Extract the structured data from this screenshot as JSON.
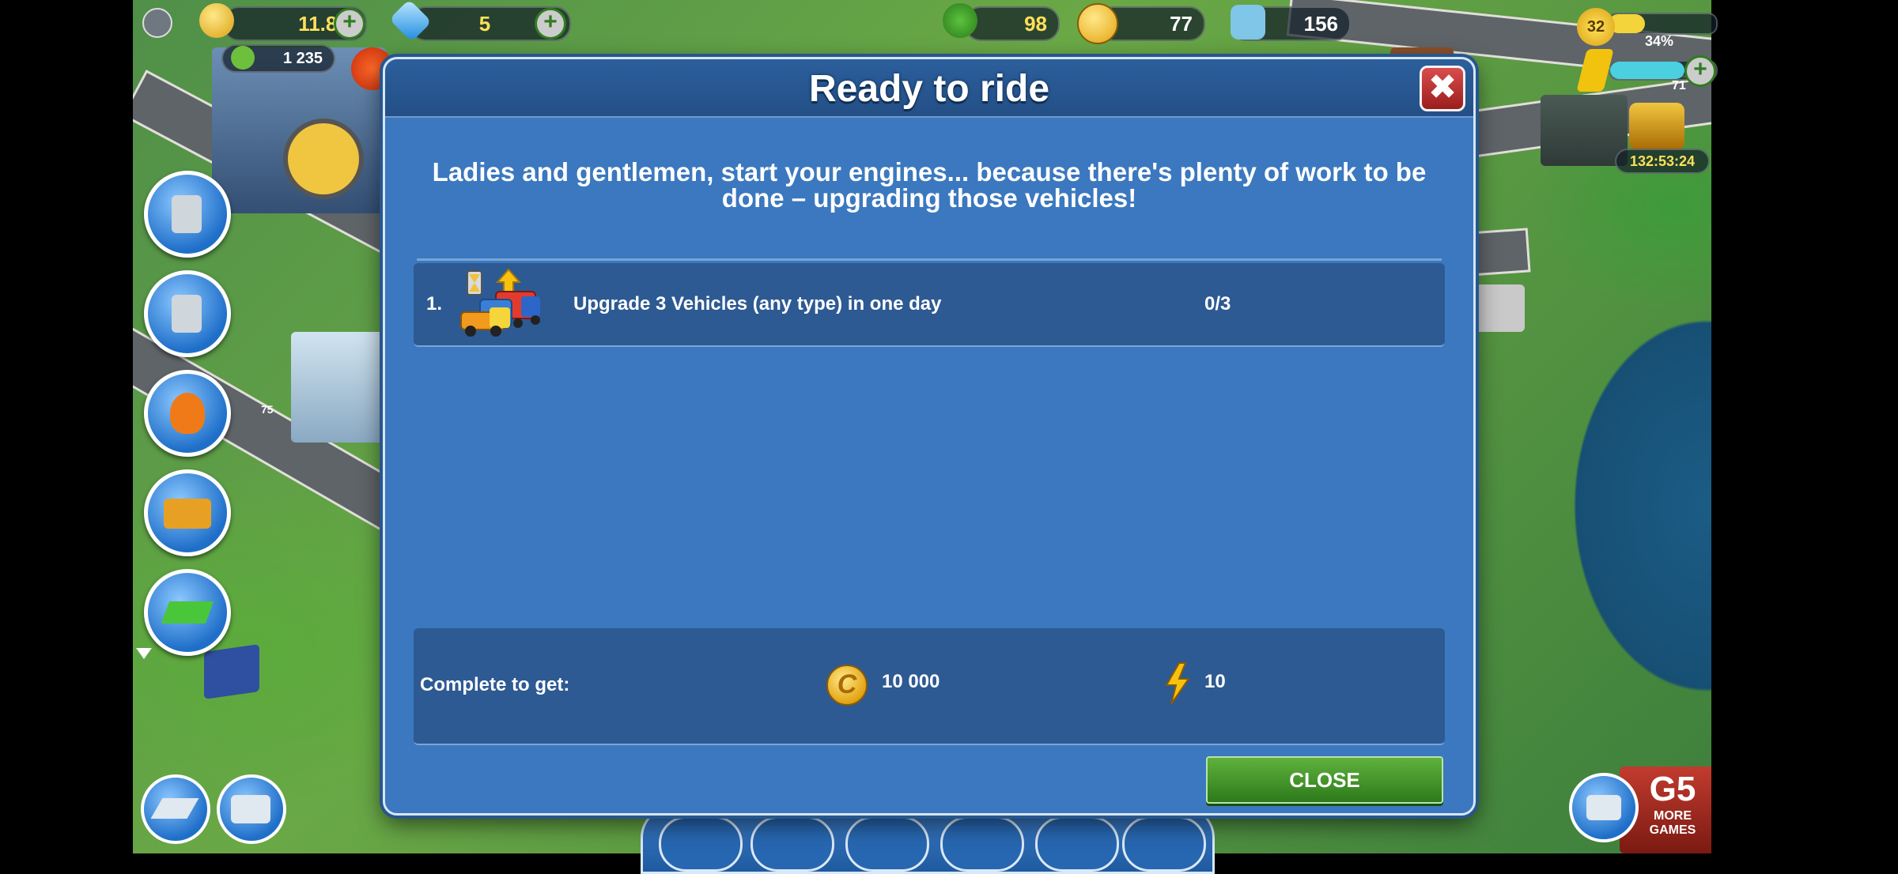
{
  "hud": {
    "money": "11.8M",
    "gems": "5",
    "trees": "98",
    "happiness": "77",
    "population": "156",
    "level": "32",
    "xp_percent": "34%",
    "sub_money": "1 235",
    "energy_value": "71",
    "chest_timer": "132:53:24"
  },
  "side_buttons": {
    "side_counter": "75"
  },
  "modal": {
    "title": "Ready to ride",
    "description": "Ladies and gentlemen, start your engines... because there's plenty of work to be done – upgrading those vehicles!",
    "task": {
      "number": "1.",
      "text": "Upgrade 3 Vehicles (any type) in one day",
      "progress": "0/3"
    },
    "reward": {
      "label": "Complete to get:",
      "coins": "10 000",
      "energy": "10"
    },
    "close_label": "CLOSE",
    "close_x": "✖"
  },
  "bottom": {
    "more_games_brand": "G5",
    "more_games_label": "MORE GAMES"
  },
  "colors": {
    "modal_bg": "#3b78bf",
    "panel_bg": "#2d5a92",
    "close_green": "#3f9429",
    "close_red": "#c23333"
  }
}
